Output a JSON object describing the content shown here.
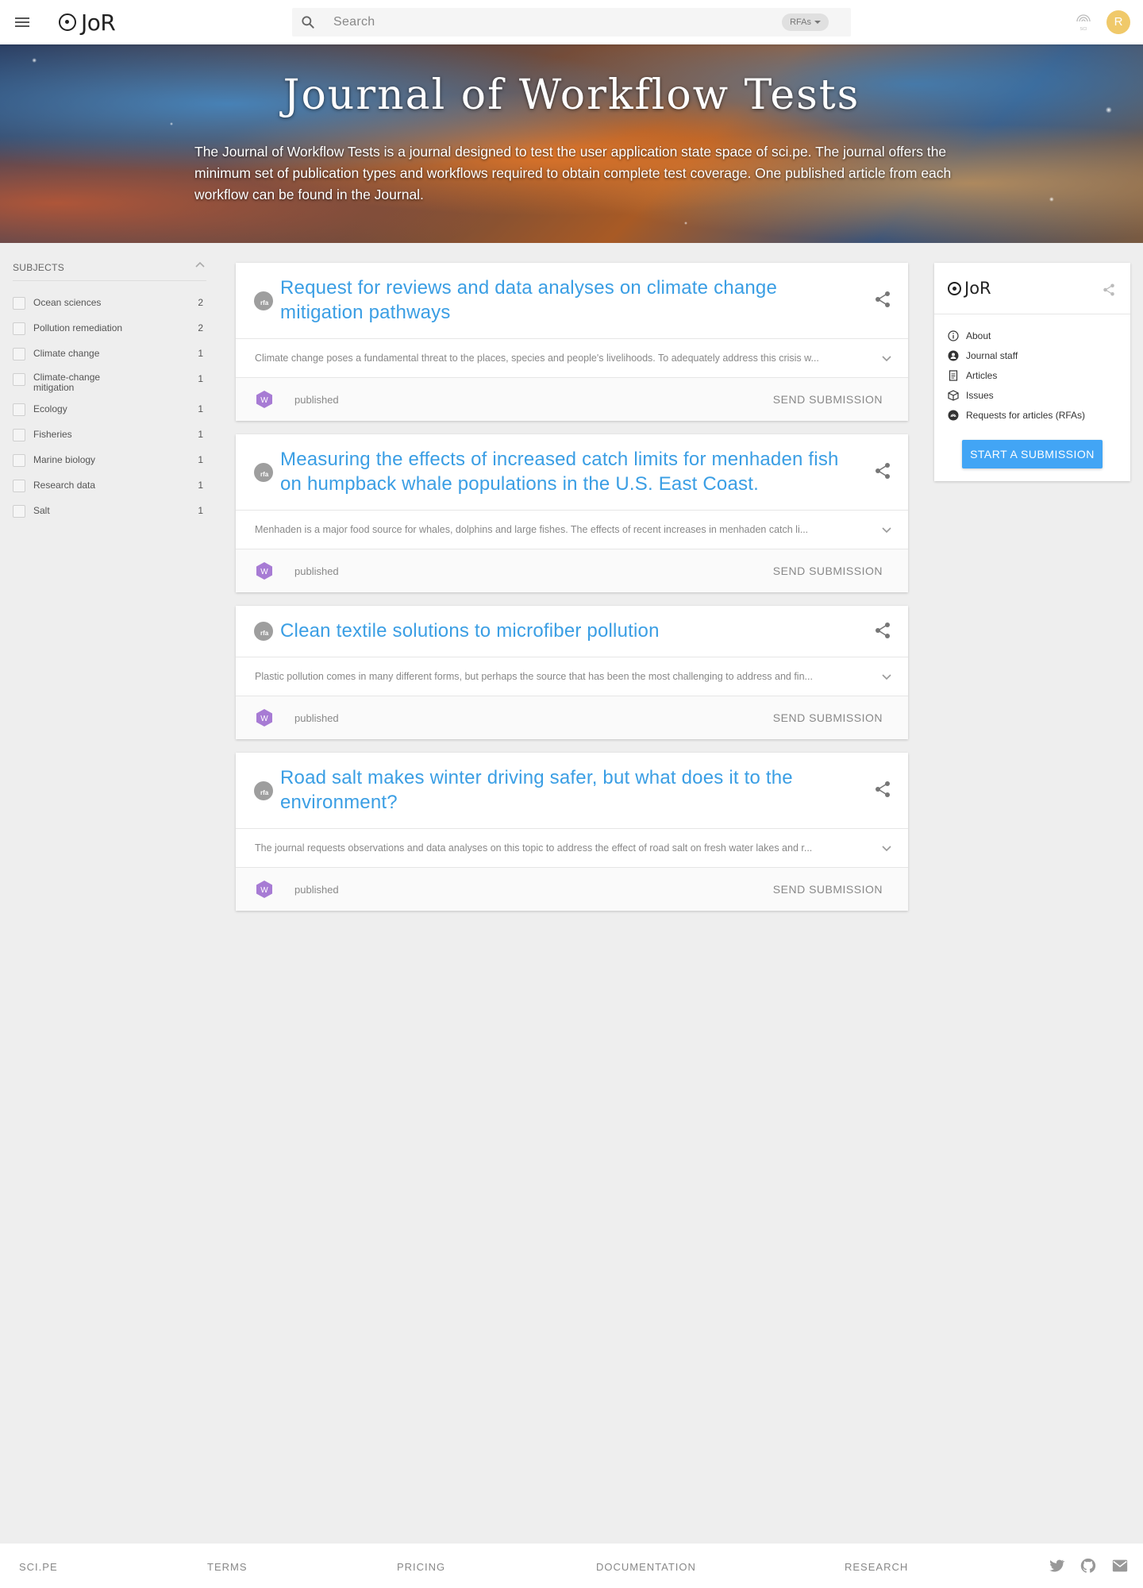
{
  "header": {
    "logo_text": "JoR",
    "search_placeholder": "Search",
    "search_scope": "RFAs",
    "sci_icon_label": "SCI",
    "avatar_initial": "R"
  },
  "hero": {
    "title": "Journal of Workflow Tests",
    "description": "The Journal of Workflow Tests is a journal designed to test the user application state space of sci.pe. The journal offers the minimum set of publication types and workflows required to obtain complete test coverage. One published article from each workflow can be found in the Journal."
  },
  "subjects": {
    "title": "SUBJECTS",
    "items": [
      {
        "label": "Ocean sciences",
        "count": "2"
      },
      {
        "label": "Pollution remediation",
        "count": "2"
      },
      {
        "label": "Climate change",
        "count": "1"
      },
      {
        "label": "Climate-change mitigation",
        "count": "1"
      },
      {
        "label": "Ecology",
        "count": "1"
      },
      {
        "label": "Fisheries",
        "count": "1"
      },
      {
        "label": "Marine biology",
        "count": "1"
      },
      {
        "label": "Research data",
        "count": "1"
      },
      {
        "label": "Salt",
        "count": "1"
      }
    ]
  },
  "cards": [
    {
      "title": "Request for reviews and data analyses on climate change mitigation pathways",
      "abstract": "Climate change poses a fundamental threat to the places, species and people's livelihoods. To adequately address this crisis w...",
      "badge": "W",
      "status": "published",
      "action": "SEND SUBMISSION"
    },
    {
      "title": "Measuring the effects of increased catch limits for menhaden fish on humpback whale populations in the U.S. East Coast.",
      "abstract": "Menhaden is a major food source for whales, dolphins and large fishes. The effects of recent increases in menhaden catch li...",
      "badge": "W",
      "status": "published",
      "action": "SEND SUBMISSION"
    },
    {
      "title": "Clean textile solutions to microfiber pollution",
      "abstract": "Plastic pollution comes in many different forms, but perhaps the source that has been the most challenging to address and fin...",
      "badge": "W",
      "status": "published",
      "action": "SEND SUBMISSION"
    },
    {
      "title": "Road salt makes winter driving safer, but what does it to the environment?",
      "abstract": "The journal requests observations and data analyses on this topic to address the effect of road salt on fresh water lakes and r...",
      "badge": "W",
      "status": "published",
      "action": "SEND SUBMISSION"
    }
  ],
  "rfa_icon_text": "rfa",
  "journal_card": {
    "logo_text": "JoR",
    "nav": [
      {
        "label": "About",
        "icon": "info-icon"
      },
      {
        "label": "Journal staff",
        "icon": "staff-icon"
      },
      {
        "label": "Articles",
        "icon": "article-icon"
      },
      {
        "label": "Issues",
        "icon": "issues-icon"
      },
      {
        "label": "Requests for articles (RFAs)",
        "icon": "rfa-icon"
      }
    ],
    "start_button": "START A SUBMISSION"
  },
  "footer": {
    "links": [
      "SCI.PE",
      "TERMS",
      "PRICING",
      "DOCUMENTATION",
      "RESEARCH"
    ],
    "icons": [
      "twitter-icon",
      "github-icon",
      "email-icon"
    ]
  },
  "colors": {
    "link_blue": "#3a9ee4",
    "button_blue": "#42a5f5",
    "avatar": "#f0c96a",
    "badge_purple": "#a77bd4",
    "background": "#eeeeee"
  }
}
